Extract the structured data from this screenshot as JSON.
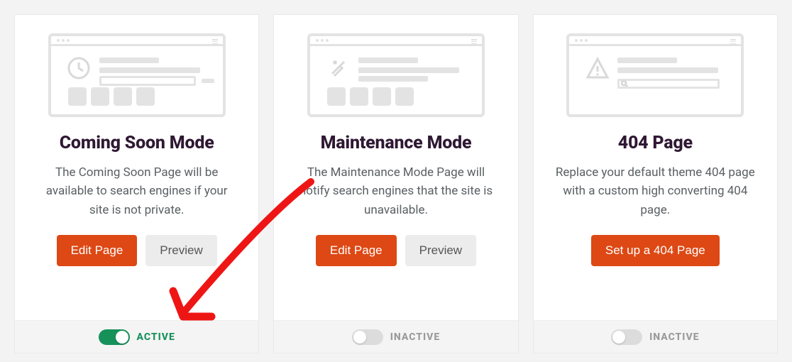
{
  "cards": [
    {
      "title": "Coming Soon Mode",
      "desc": "The Coming Soon Page will be available to search engines if your site is not private.",
      "primary": "Edit Page",
      "secondary": "Preview",
      "status": "ACTIVE"
    },
    {
      "title": "Maintenance Mode",
      "desc": "The Maintenance Mode Page will notify search engines that the site is unavailable.",
      "primary": "Edit Page",
      "secondary": "Preview",
      "status": "INACTIVE"
    },
    {
      "title": "404 Page",
      "desc": "Replace your default theme 404 page with a custom high converting 404 page.",
      "primary": "Set up a 404 Page",
      "status": "INACTIVE"
    }
  ]
}
